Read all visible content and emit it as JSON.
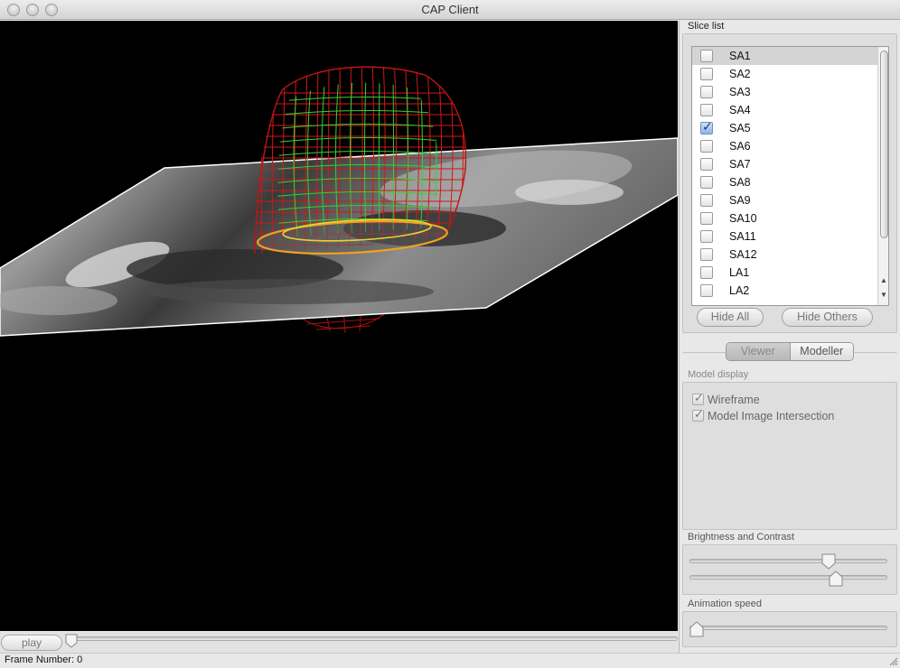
{
  "window": {
    "title": "CAP Client"
  },
  "slice_list": {
    "title": "Slice list",
    "items": [
      {
        "label": "SA1",
        "checked": false,
        "selected": true
      },
      {
        "label": "SA2",
        "checked": false
      },
      {
        "label": "SA3",
        "checked": false
      },
      {
        "label": "SA4",
        "checked": false
      },
      {
        "label": "SA5",
        "checked": true
      },
      {
        "label": "SA6",
        "checked": false
      },
      {
        "label": "SA7",
        "checked": false
      },
      {
        "label": "SA8",
        "checked": false
      },
      {
        "label": "SA9",
        "checked": false
      },
      {
        "label": "SA10",
        "checked": false
      },
      {
        "label": "SA11",
        "checked": false
      },
      {
        "label": "SA12",
        "checked": false
      },
      {
        "label": "LA1",
        "checked": false
      },
      {
        "label": "LA2",
        "checked": false
      }
    ],
    "hide_all_label": "Hide All",
    "hide_others_label": "Hide Others"
  },
  "mode_tabs": {
    "viewer_label": "Viewer",
    "modeller_label": "Modeller",
    "active": "Viewer"
  },
  "model_display": {
    "title": "Model display",
    "wireframe_label": "Wireframe",
    "wireframe_checked": true,
    "intersection_label": "Model Image Intersection",
    "intersection_checked": true
  },
  "brightness_contrast": {
    "title": "Brightness and Contrast",
    "brightness_fraction": 0.72,
    "contrast_fraction": 0.76
  },
  "animation_speed": {
    "title": "Animation speed",
    "fraction": 0.0
  },
  "playback": {
    "play_label": "play",
    "frame_label": "Frame Number: 0",
    "position_fraction": 0.0
  },
  "colors": {
    "viewport_bg": "#000000",
    "epicardium_mesh": "#d01818",
    "endocardium_mesh": "#2ecc2e",
    "intersection_contour": "#f0a020"
  }
}
